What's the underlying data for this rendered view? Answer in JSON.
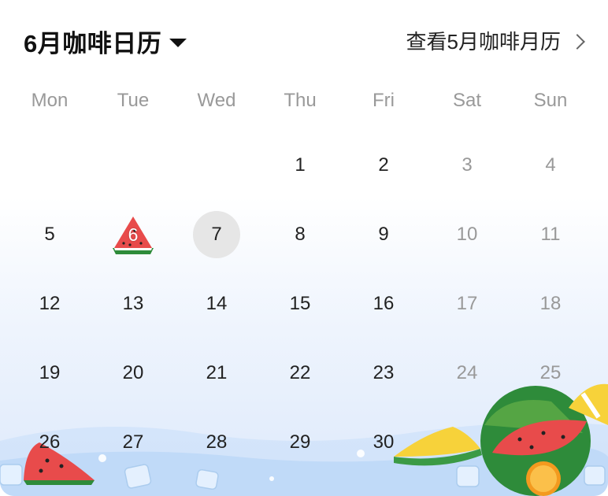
{
  "header": {
    "title": "6月咖啡日历",
    "link_label": "查看5月咖啡月历"
  },
  "weekdays": [
    "Mon",
    "Tue",
    "Wed",
    "Thu",
    "Fri",
    "Sat",
    "Sun"
  ],
  "calendar": {
    "leading_blanks": 3,
    "days": [
      "1",
      "2",
      "3",
      "4",
      "5",
      "6",
      "7",
      "8",
      "9",
      "10",
      "11",
      "12",
      "13",
      "14",
      "15",
      "16",
      "17",
      "18",
      "19",
      "20",
      "21",
      "22",
      "23",
      "24",
      "25",
      "26",
      "27",
      "28",
      "29",
      "30"
    ],
    "today": "7",
    "marked_day": "6",
    "marked_icon": "watermelon-icon"
  },
  "colors": {
    "text": "#222222",
    "weekend": "#999999",
    "today_bg": "#e6e6e6",
    "melon_red": "#e84b4b",
    "rind_green": "#2e8b3a"
  }
}
